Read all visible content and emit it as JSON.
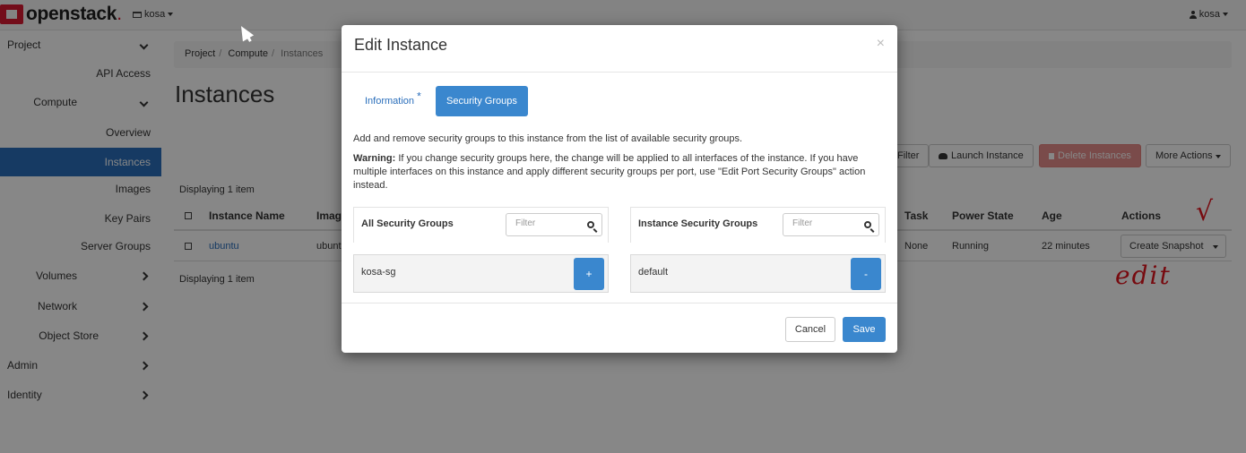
{
  "navbar": {
    "brand": "openstack",
    "brand_dot": ".",
    "project": "kosa",
    "user": "kosa"
  },
  "sidebar": {
    "project": "Project",
    "api_access": "API Access",
    "compute": "Compute",
    "overview": "Overview",
    "instances": "Instances",
    "images": "Images",
    "key_pairs": "Key Pairs",
    "server_groups": "Server Groups",
    "volumes": "Volumes",
    "network": "Network",
    "object_store": "Object Store",
    "admin": "Admin",
    "identity": "Identity"
  },
  "breadcrumb": [
    "Project",
    "Compute",
    "Instances"
  ],
  "page_title": "Instances",
  "toolbar": {
    "filter": "Filter",
    "launch": "Launch Instance",
    "delete": "Delete Instances",
    "more": "More Actions"
  },
  "displaying": "Displaying 1 item",
  "table": {
    "headers": {
      "name": "Instance Name",
      "image": "Image",
      "task": "Task",
      "power": "Power State",
      "age": "Age",
      "actions": "Actions"
    },
    "rows": [
      {
        "name": "ubuntu",
        "image": "ubuntu",
        "task": "None",
        "power": "Running",
        "age": "22 minutes",
        "action": "Create Snapshot"
      }
    ]
  },
  "annotation": {
    "check": "√",
    "text": "edit"
  },
  "modal": {
    "title": "Edit Instance",
    "close": "×",
    "tab_info": "Information",
    "tab_info_required": "*",
    "tab_security": "Security Groups",
    "help_text": "Add and remove security groups to this instance from the list of available security groups.",
    "warning_label": "Warning:",
    "warning_text": "If you change security groups here, the change will be applied to all interfaces of the instance. If you have multiple interfaces on this instance and apply different security groups per port, use \"Edit Port Security Groups\" action instead.",
    "all_groups": {
      "title": "All Security Groups",
      "filter_placeholder": "Filter",
      "items": [
        {
          "name": "kosa-sg",
          "button": "+"
        }
      ]
    },
    "instance_groups": {
      "title": "Instance Security Groups",
      "filter_placeholder": "Filter",
      "items": [
        {
          "name": "default",
          "button": "-"
        }
      ]
    },
    "cancel": "Cancel",
    "save": "Save"
  },
  "colors": {
    "primary": "#3a87ce",
    "active_nav": "#2a6ebb",
    "danger": "#d9534f",
    "brand_red": "#da1a32",
    "annotation_red": "#e0141e"
  }
}
